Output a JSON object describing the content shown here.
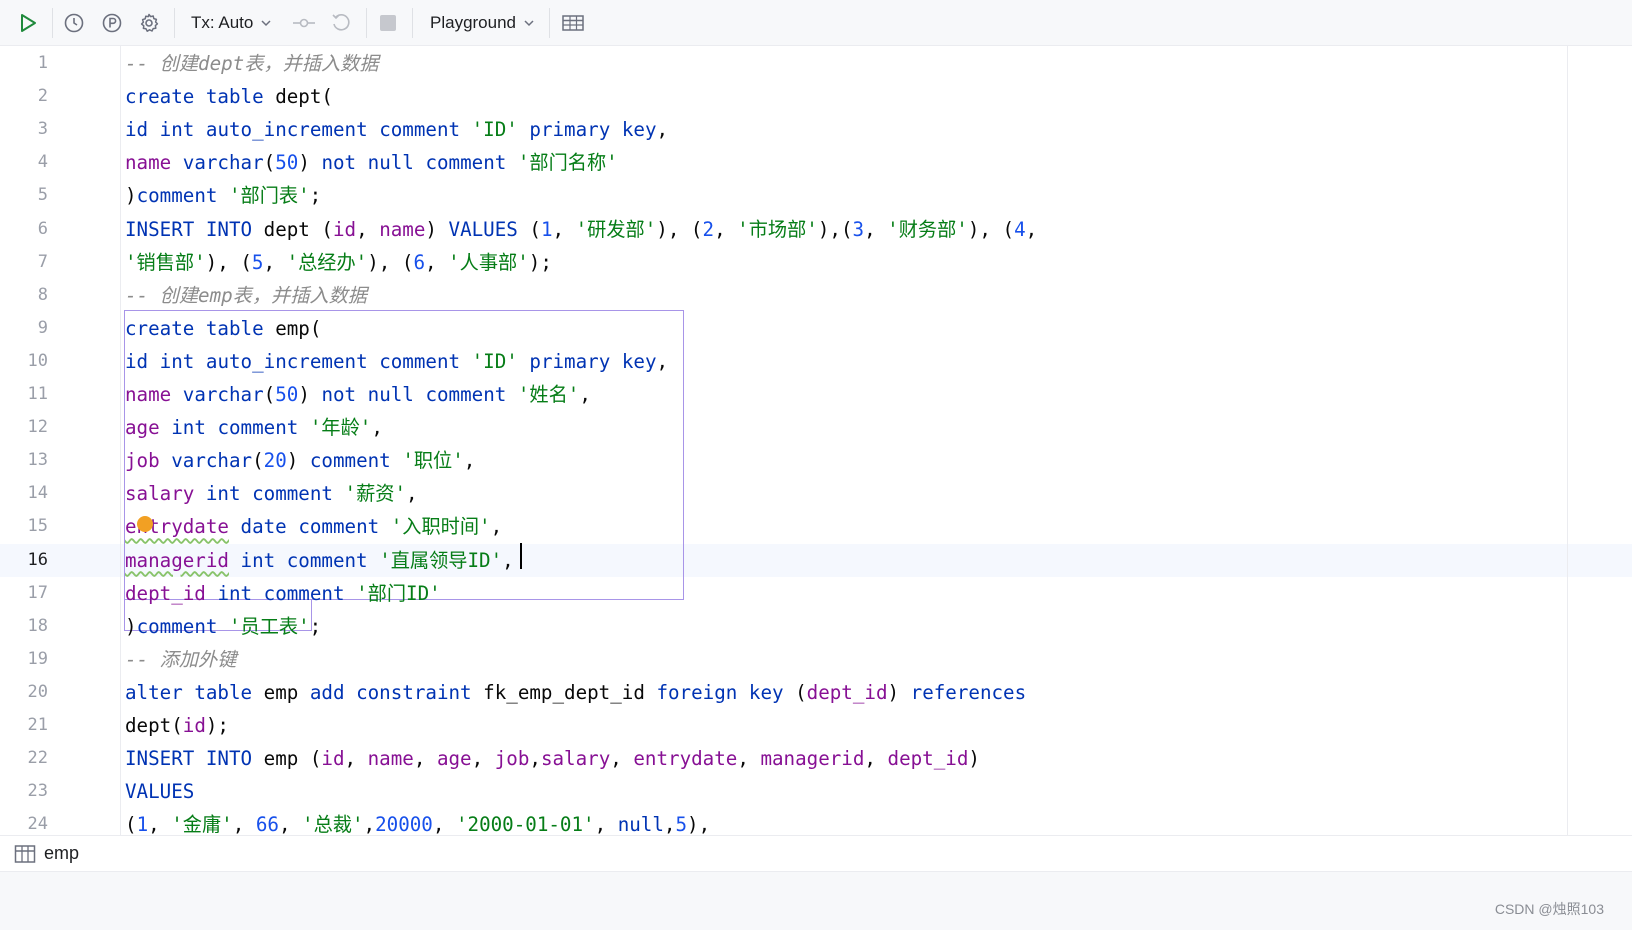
{
  "toolbar": {
    "icons": [
      "run-icon",
      "history-icon",
      "pin-icon",
      "settings-icon",
      "commit-icon",
      "rollback-icon",
      "stop-icon",
      "table-view-icon"
    ],
    "tx_label": "Tx: Auto",
    "session_label": "Playground"
  },
  "editor": {
    "current_line": 16,
    "line_numbers": [
      "1",
      "2",
      "3",
      "4",
      "5",
      "6",
      "7",
      "8",
      "9",
      "10",
      "11",
      "12",
      "13",
      "14",
      "15",
      "16",
      "17",
      "18",
      "19",
      "20",
      "21",
      "22",
      "23",
      "24"
    ],
    "lines": [
      [
        [
          "cm",
          "-- 创建dept表，并插入数据"
        ]
      ],
      [
        [
          "kw",
          "create"
        ],
        [
          "pl",
          " "
        ],
        [
          "kw",
          "table"
        ],
        [
          "pl",
          " dept("
        ]
      ],
      [
        [
          "kw",
          "id"
        ],
        [
          "pl",
          " "
        ],
        [
          "kw",
          "int"
        ],
        [
          "pl",
          " "
        ],
        [
          "kw",
          "auto_increment"
        ],
        [
          "pl",
          " "
        ],
        [
          "kw",
          "comment"
        ],
        [
          "pl",
          " "
        ],
        [
          "str",
          "'ID'"
        ],
        [
          "pl",
          " "
        ],
        [
          "kw",
          "primary"
        ],
        [
          "pl",
          " "
        ],
        [
          "kw",
          "key"
        ],
        [
          "pl",
          ","
        ]
      ],
      [
        [
          "id",
          "name"
        ],
        [
          "pl",
          " "
        ],
        [
          "kw",
          "varchar"
        ],
        [
          "pl",
          "("
        ],
        [
          "num",
          "50"
        ],
        [
          "pl",
          ") "
        ],
        [
          "kw",
          "not"
        ],
        [
          "pl",
          " "
        ],
        [
          "kw",
          "null"
        ],
        [
          "pl",
          " "
        ],
        [
          "kw",
          "comment"
        ],
        [
          "pl",
          " "
        ],
        [
          "str",
          "'部门名称'"
        ]
      ],
      [
        [
          "pl",
          ")"
        ],
        [
          "kw",
          "comment"
        ],
        [
          "pl",
          " "
        ],
        [
          "str",
          "'部门表'"
        ],
        [
          "pl",
          ";"
        ]
      ],
      [
        [
          "kw",
          "INSERT"
        ],
        [
          "pl",
          " "
        ],
        [
          "kw",
          "INTO"
        ],
        [
          "pl",
          " dept ("
        ],
        [
          "id",
          "id"
        ],
        [
          "pl",
          ", "
        ],
        [
          "id",
          "name"
        ],
        [
          "pl",
          ") "
        ],
        [
          "kw",
          "VALUES"
        ],
        [
          "pl",
          " ("
        ],
        [
          "num",
          "1"
        ],
        [
          "pl",
          ", "
        ],
        [
          "str",
          "'研发部'"
        ],
        [
          "pl",
          "), ("
        ],
        [
          "num",
          "2"
        ],
        [
          "pl",
          ", "
        ],
        [
          "str",
          "'市场部'"
        ],
        [
          "pl",
          "),("
        ],
        [
          "num",
          "3"
        ],
        [
          "pl",
          ", "
        ],
        [
          "str",
          "'财务部'"
        ],
        [
          "pl",
          "), ("
        ],
        [
          "num",
          "4"
        ],
        [
          "pl",
          ","
        ]
      ],
      [
        [
          "str",
          "'销售部'"
        ],
        [
          "pl",
          "), ("
        ],
        [
          "num",
          "5"
        ],
        [
          "pl",
          ", "
        ],
        [
          "str",
          "'总经办'"
        ],
        [
          "pl",
          "), ("
        ],
        [
          "num",
          "6"
        ],
        [
          "pl",
          ", "
        ],
        [
          "str",
          "'人事部'"
        ],
        [
          "pl",
          ");"
        ]
      ],
      [
        [
          "cm",
          "-- 创建emp表，并插入数据"
        ]
      ],
      [
        [
          "kw",
          "create"
        ],
        [
          "pl",
          " "
        ],
        [
          "kw",
          "table"
        ],
        [
          "pl",
          " emp("
        ]
      ],
      [
        [
          "kw",
          "id"
        ],
        [
          "pl",
          " "
        ],
        [
          "kw",
          "int"
        ],
        [
          "pl",
          " "
        ],
        [
          "kw",
          "auto_increment"
        ],
        [
          "pl",
          " "
        ],
        [
          "kw",
          "comment"
        ],
        [
          "pl",
          " "
        ],
        [
          "str",
          "'ID'"
        ],
        [
          "pl",
          " "
        ],
        [
          "kw",
          "primary"
        ],
        [
          "pl",
          " "
        ],
        [
          "kw",
          "key"
        ],
        [
          "pl",
          ","
        ]
      ],
      [
        [
          "id",
          "name"
        ],
        [
          "pl",
          " "
        ],
        [
          "kw",
          "varchar"
        ],
        [
          "pl",
          "("
        ],
        [
          "num",
          "50"
        ],
        [
          "pl",
          ") "
        ],
        [
          "kw",
          "not"
        ],
        [
          "pl",
          " "
        ],
        [
          "kw",
          "null"
        ],
        [
          "pl",
          " "
        ],
        [
          "kw",
          "comment"
        ],
        [
          "pl",
          " "
        ],
        [
          "str",
          "'姓名'"
        ],
        [
          "pl",
          ","
        ]
      ],
      [
        [
          "id",
          "age"
        ],
        [
          "pl",
          " "
        ],
        [
          "kw",
          "int"
        ],
        [
          "pl",
          " "
        ],
        [
          "kw",
          "comment"
        ],
        [
          "pl",
          " "
        ],
        [
          "str",
          "'年龄'"
        ],
        [
          "pl",
          ","
        ]
      ],
      [
        [
          "id",
          "job"
        ],
        [
          "pl",
          " "
        ],
        [
          "kw",
          "varchar"
        ],
        [
          "pl",
          "("
        ],
        [
          "num",
          "20"
        ],
        [
          "pl",
          ") "
        ],
        [
          "kw",
          "comment"
        ],
        [
          "pl",
          " "
        ],
        [
          "str",
          "'职位'"
        ],
        [
          "pl",
          ","
        ]
      ],
      [
        [
          "id",
          "salary"
        ],
        [
          "pl",
          " "
        ],
        [
          "kw",
          "int"
        ],
        [
          "pl",
          " "
        ],
        [
          "kw",
          "comment"
        ],
        [
          "pl",
          " "
        ],
        [
          "str",
          "'薪资'"
        ],
        [
          "pl",
          ","
        ]
      ],
      [
        [
          "err",
          "entrydate"
        ],
        [
          "pl",
          " "
        ],
        [
          "kw",
          "date"
        ],
        [
          "pl",
          " "
        ],
        [
          "kw",
          "comment"
        ],
        [
          "pl",
          " "
        ],
        [
          "str",
          "'入职时间'"
        ],
        [
          "pl",
          ","
        ]
      ],
      [
        [
          "err",
          "managerid"
        ],
        [
          "pl",
          " "
        ],
        [
          "kw",
          "int"
        ],
        [
          "pl",
          " "
        ],
        [
          "kw",
          "comment"
        ],
        [
          "pl",
          " "
        ],
        [
          "str",
          "'直属领导ID'"
        ],
        [
          "pl",
          ","
        ]
      ],
      [
        [
          "id",
          "dept_id"
        ],
        [
          "pl",
          " "
        ],
        [
          "kw",
          "int"
        ],
        [
          "pl",
          " "
        ],
        [
          "kw",
          "comment"
        ],
        [
          "pl",
          " "
        ],
        [
          "str",
          "'部门ID'"
        ]
      ],
      [
        [
          "pl",
          ")"
        ],
        [
          "kw",
          "comment"
        ],
        [
          "pl",
          " "
        ],
        [
          "str",
          "'员工表'"
        ],
        [
          "pl",
          ";"
        ]
      ],
      [
        [
          "cm",
          "-- 添加外键"
        ]
      ],
      [
        [
          "kw",
          "alter"
        ],
        [
          "pl",
          " "
        ],
        [
          "kw",
          "table"
        ],
        [
          "pl",
          " emp "
        ],
        [
          "kw",
          "add"
        ],
        [
          "pl",
          " "
        ],
        [
          "kw",
          "constraint"
        ],
        [
          "pl",
          " fk_emp_dept_id "
        ],
        [
          "kw",
          "foreign"
        ],
        [
          "pl",
          " "
        ],
        [
          "kw",
          "key"
        ],
        [
          "pl",
          " ("
        ],
        [
          "id",
          "dept_id"
        ],
        [
          "pl",
          ") "
        ],
        [
          "kw",
          "references"
        ]
      ],
      [
        [
          "pl",
          "dept("
        ],
        [
          "id",
          "id"
        ],
        [
          "pl",
          ");"
        ]
      ],
      [
        [
          "kw",
          "INSERT"
        ],
        [
          "pl",
          " "
        ],
        [
          "kw",
          "INTO"
        ],
        [
          "pl",
          " emp ("
        ],
        [
          "id",
          "id"
        ],
        [
          "pl",
          ", "
        ],
        [
          "id",
          "name"
        ],
        [
          "pl",
          ", "
        ],
        [
          "id",
          "age"
        ],
        [
          "pl",
          ", "
        ],
        [
          "id",
          "job"
        ],
        [
          "pl",
          ","
        ],
        [
          "id",
          "salary"
        ],
        [
          "pl",
          ", "
        ],
        [
          "id",
          "entrydate"
        ],
        [
          "pl",
          ", "
        ],
        [
          "id",
          "managerid"
        ],
        [
          "pl",
          ", "
        ],
        [
          "id",
          "dept_id"
        ],
        [
          "pl",
          ")"
        ]
      ],
      [
        [
          "kw",
          "VALUES"
        ]
      ],
      [
        [
          "pl",
          "("
        ],
        [
          "num",
          "1"
        ],
        [
          "pl",
          ", "
        ],
        [
          "str",
          "'金庸'"
        ],
        [
          "pl",
          ", "
        ],
        [
          "num",
          "66"
        ],
        [
          "pl",
          ", "
        ],
        [
          "str",
          "'总裁'"
        ],
        [
          "pl",
          ","
        ],
        [
          "num",
          "20000"
        ],
        [
          "pl",
          ", "
        ],
        [
          "str",
          "'2000-01-01'"
        ],
        [
          "pl",
          ", "
        ],
        [
          "kw",
          "null"
        ],
        [
          "pl",
          ","
        ],
        [
          "num",
          "5"
        ],
        [
          "pl",
          "),"
        ]
      ]
    ]
  },
  "results": {
    "tab_label": "emp",
    "tab_icon": "table-icon"
  },
  "watermark": "CSDN @烛照103"
}
